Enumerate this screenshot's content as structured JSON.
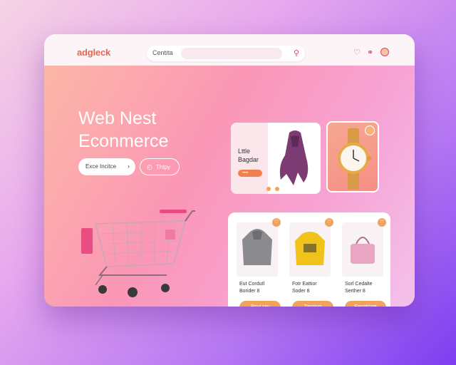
{
  "app": {
    "logo_text": "adgleck"
  },
  "search": {
    "label": "Centita"
  },
  "header": {
    "headline_line1": "Web Nest",
    "headline_line2": "Econmerce"
  },
  "hero": {
    "primary_button": "Exce Incitce",
    "secondary_button": "Thtpy",
    "subtext": "· · · · · · · · ·"
  },
  "promo": {
    "title_line1": "Lttle",
    "title_line2": "Bagdar",
    "pill": "••••"
  },
  "products": [
    {
      "name": "Eut Cordutl",
      "price": "Borider 8",
      "cta": "Pout ray",
      "image": "hoodie-image",
      "color": "#8a8a8f"
    },
    {
      "name": "Fotr Eattior",
      "price": "Soder 8",
      "cta": "Tanging",
      "image": "sweatshirt-image",
      "color": "#f0c21a"
    },
    {
      "name": "Sorl Cedalte",
      "price": "Serther 8",
      "cta": "Eeoatinge",
      "image": "handbag-image",
      "color": "#e9a6c3"
    }
  ],
  "colors": {
    "accent": "#f2a35b",
    "brand": "#d24b6c"
  },
  "icons": {
    "search": "search-icon",
    "user": "user-icon",
    "settings": "settings-icon",
    "avatar": "avatar"
  }
}
